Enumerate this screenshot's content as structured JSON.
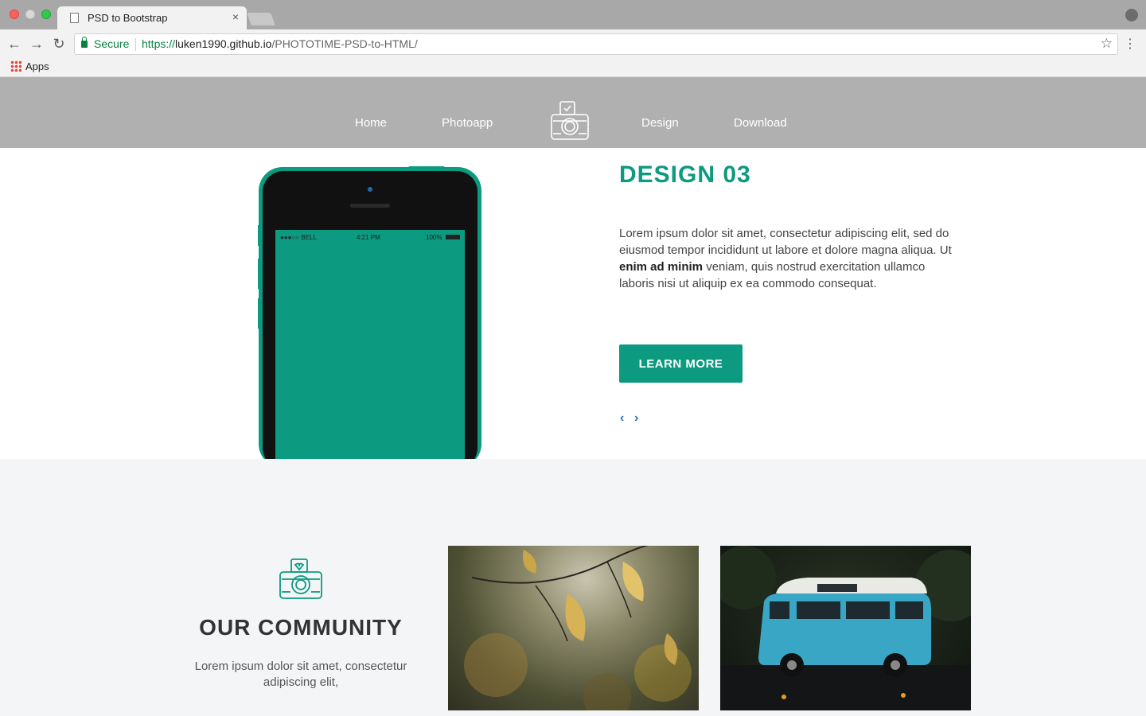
{
  "browser": {
    "tab_title": "PSD to Bootstrap",
    "tab_close": "×",
    "secure_label": "Secure",
    "url_scheme": "https://",
    "url_host": "luken1990.github.io",
    "url_path": "/PHOTOTIME-PSD-to-HTML/",
    "bookmarks": [
      {
        "label": "Apps"
      }
    ],
    "icons": [
      "back-icon",
      "forward-icon",
      "reload-icon",
      "lock-icon",
      "star-icon",
      "menu-icon",
      "profile-icon",
      "apps-icon"
    ]
  },
  "site": {
    "nav": {
      "items": [
        {
          "label": "Home"
        },
        {
          "label": "Photoapp"
        },
        {
          "label": "Design"
        },
        {
          "label": "Download"
        }
      ]
    },
    "hero": {
      "title": "DESIGN 03",
      "text_before": "Lorem ipsum dolor sit amet, consectetur adipiscing elit, sed do eiusmod tempor incididunt ut labore et dolore magna aliqua. Ut ",
      "text_bold": "enim ad minim",
      "text_after": " veniam, quis nostrud exercitation ullamco laboris nisi ut aliquip ex ea commodo consequat.",
      "button_label": "LEARN MORE",
      "prev_arrow": "‹",
      "next_arrow": "›",
      "phone_status": {
        "carrier": "●●●○○ BELL",
        "time": "4:21 PM",
        "battery": "100%"
      }
    },
    "community": {
      "title": "OUR COMMUNITY",
      "text": "Lorem ipsum dolor sit amet, consectetur adipiscing elit,"
    },
    "colors": {
      "accent": "#0c9a80",
      "nav_bg": "#b0b0b0",
      "section_bg": "#f4f5f7",
      "arrow": "#2a6fb5"
    }
  }
}
